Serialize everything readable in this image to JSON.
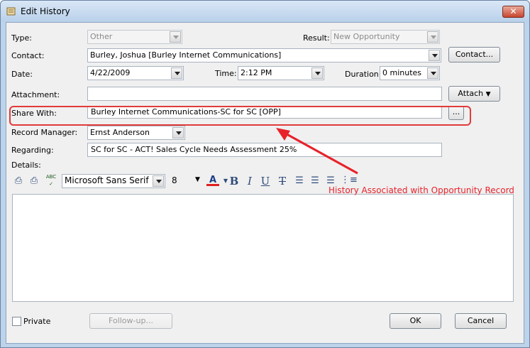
{
  "window": {
    "title": "Edit History",
    "close_glyph": "✕"
  },
  "type": {
    "label": "Type:",
    "value": "Other"
  },
  "result": {
    "label": "Result:",
    "value": "New Opportunity"
  },
  "contact": {
    "label": "Contact:",
    "value": "Burley, Joshua [Burley Internet Communications]",
    "button": "Contact..."
  },
  "date": {
    "label": "Date:",
    "value": "4/22/2009"
  },
  "time": {
    "label": "Time:",
    "value": "2:12 PM"
  },
  "duration": {
    "label": "Duration:",
    "value": "0 minutes"
  },
  "attachment": {
    "label": "Attachment:",
    "value": "",
    "button": "Attach"
  },
  "share_with": {
    "label": "Share With:",
    "value": "Burley Internet Communications-SC for SC [OPP]",
    "button": "..."
  },
  "record_manager": {
    "label": "Record Manager:",
    "value": "Ernst Anderson"
  },
  "regarding": {
    "label": "Regarding:",
    "value": "SC for SC - ACT! Sales Cycle Needs Assessment 25%"
  },
  "details": {
    "label": "Details:",
    "font_name": "Microsoft Sans Serif",
    "font_size": "8",
    "body": "",
    "toolbar": {
      "bold": "B",
      "italic": "I",
      "underline": "U",
      "strikethrough": "T",
      "font_color": "A",
      "spell": "ABC"
    }
  },
  "annotation": {
    "text": "History Associated with Opportunity Record",
    "color": "#e8222a"
  },
  "footer": {
    "private_label": "Private",
    "followup_button": "Follow-up...",
    "ok_button": "OK",
    "cancel_button": "Cancel"
  }
}
